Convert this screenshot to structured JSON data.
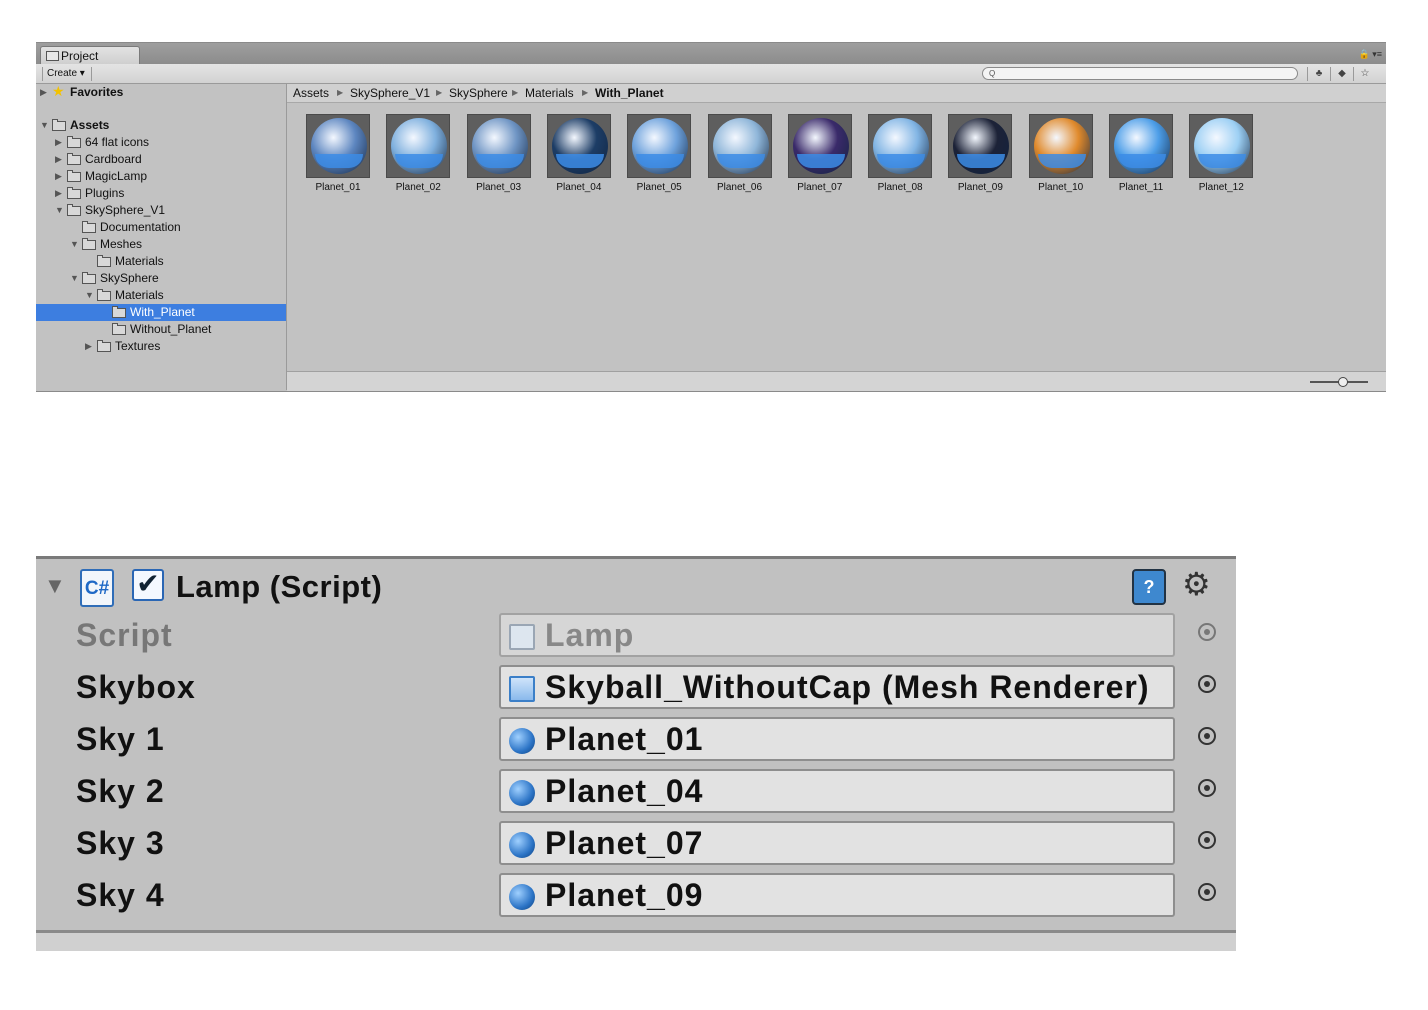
{
  "project": {
    "tab_label": "Project",
    "create_label": "Create",
    "search": {
      "placeholder": ""
    },
    "tree": [
      {
        "label": "Favorites",
        "arrow": "▶",
        "icon": "star-icon",
        "bold": true
      },
      {
        "label": "Assets",
        "arrow": "▼",
        "icon": "folder-icon",
        "bold": true
      },
      {
        "label": "64 flat icons",
        "arrow": "▶",
        "icon": "folder-icon"
      },
      {
        "label": "Cardboard",
        "arrow": "▶",
        "icon": "folder-icon"
      },
      {
        "label": "MagicLamp",
        "arrow": "▶",
        "icon": "folder-icon"
      },
      {
        "label": "Plugins",
        "arrow": "▶",
        "icon": "folder-icon"
      },
      {
        "label": "SkySphere_V1",
        "arrow": "▼",
        "icon": "folder-icon"
      },
      {
        "label": "Documentation",
        "arrow": "",
        "icon": "folder-icon"
      },
      {
        "label": "Meshes",
        "arrow": "▼",
        "icon": "folder-icon"
      },
      {
        "label": "Materials",
        "arrow": "",
        "icon": "folder-icon"
      },
      {
        "label": "SkySphere",
        "arrow": "▼",
        "icon": "folder-icon"
      },
      {
        "label": "Materials",
        "arrow": "▼",
        "icon": "folder-icon"
      },
      {
        "label": "With_Planet",
        "arrow": "",
        "icon": "folder-icon",
        "selected": true
      },
      {
        "label": "Without_Planet",
        "arrow": "",
        "icon": "folder-icon"
      },
      {
        "label": "Textures",
        "arrow": "▶",
        "icon": "folder-icon"
      }
    ],
    "breadcrumb": [
      "Assets",
      "SkySphere_V1",
      "SkySphere",
      "Materials",
      "With_Planet"
    ],
    "breadcrumb_separator": "▶",
    "assets": [
      {
        "label": "Planet_01",
        "color": "#5d86c0"
      },
      {
        "label": "Planet_02",
        "color": "#7fb0de"
      },
      {
        "label": "Planet_03",
        "color": "#6f95c4"
      },
      {
        "label": "Planet_04",
        "color": "#1d3d66"
      },
      {
        "label": "Planet_05",
        "color": "#6ea2dc"
      },
      {
        "label": "Planet_06",
        "color": "#8fb6d9"
      },
      {
        "label": "Planet_07",
        "color": "#3a2a6a"
      },
      {
        "label": "Planet_08",
        "color": "#82b5e4"
      },
      {
        "label": "Planet_09",
        "color": "#1c2237"
      },
      {
        "label": "Planet_10",
        "color": "#e08a2c"
      },
      {
        "label": "Planet_11",
        "color": "#4d9ee8"
      },
      {
        "label": "Planet_12",
        "color": "#9dd0f4"
      }
    ]
  },
  "inspector": {
    "foldout": "▼",
    "script_icon": "C#",
    "enabled": "✔",
    "title": "Lamp (Script)",
    "help": "?",
    "gear": "⚙",
    "fields": [
      {
        "label": "Script",
        "value": "Lamp",
        "icon": "script-file-icon",
        "disabled": true
      },
      {
        "label": "Skybox",
        "value": "Skyball_WithoutCap (Mesh Renderer)",
        "icon": "mesh-renderer-icon"
      },
      {
        "label": "Sky 1",
        "value": "Planet_01",
        "icon": "material-sphere-icon"
      },
      {
        "label": "Sky 2",
        "value": "Planet_04",
        "icon": "material-sphere-icon"
      },
      {
        "label": "Sky 3",
        "value": "Planet_07",
        "icon": "material-sphere-icon"
      },
      {
        "label": "Sky 4",
        "value": "Planet_09",
        "icon": "material-sphere-icon"
      }
    ]
  },
  "colors": {
    "selection": "#3d7ee0",
    "panel": "#c2c2c2",
    "material_blue": "#2c74c6"
  }
}
